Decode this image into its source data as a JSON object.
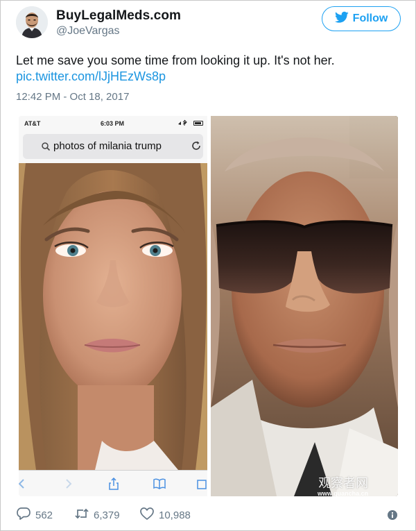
{
  "tweet": {
    "display_name": "BuyLegalMeds.com",
    "handle": "@JoeVargas",
    "follow_label": "Follow",
    "text": "Let me save you some time from looking it up. It's not her.",
    "link": "pic.twitter.com/lJjHEzWs8p",
    "timestamp": "12:42 PM - Oct 18, 2017"
  },
  "screenshot_phone": {
    "carrier": "AT&T",
    "time": "6:03 PM",
    "search_query": "photos of milania trump"
  },
  "watermark": {
    "name": "观察者网",
    "url": "www.guancha.cn"
  },
  "stats": {
    "replies": "562",
    "retweets": "6,379",
    "likes": "10,988"
  },
  "colors": {
    "accent": "#1da1f2",
    "link": "#1b95e0",
    "muted": "#657786"
  },
  "icons": [
    "twitter-bird-icon",
    "search-icon",
    "reload-icon",
    "reply-icon",
    "retweet-icon",
    "like-icon",
    "info-icon"
  ]
}
